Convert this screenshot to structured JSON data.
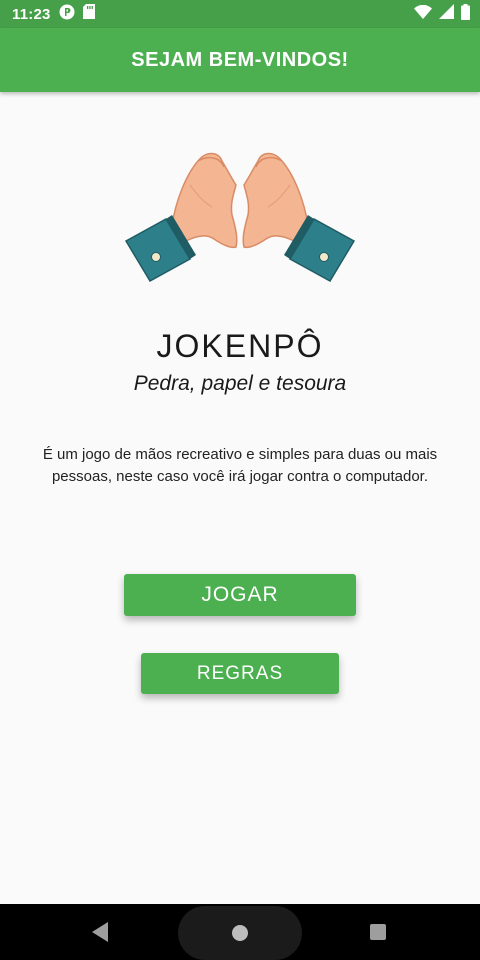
{
  "status_bar": {
    "time": "11:23"
  },
  "app_bar": {
    "title": "SEJAM BEM-VINDOS!"
  },
  "main": {
    "title": "JOKENPÔ",
    "subtitle": "Pedra, papel e tesoura",
    "description": "É um jogo de mãos recreativo e simples para duas ou mais pessoas, neste caso você irá jogar contra o computador.",
    "play_button": "JOGAR",
    "rules_button": "REGRAS"
  },
  "colors": {
    "primary": "#4caf50",
    "primary_dark": "#46a049",
    "background": "#fafafa",
    "skin": "#f4b692",
    "cuff": "#2d7f8a"
  },
  "icons": {
    "status_left": [
      "notification-icon",
      "sd-card-icon"
    ],
    "status_right": [
      "wifi-icon",
      "signal-icon",
      "battery-icon"
    ],
    "hero": "heart-hands-icon",
    "nav": [
      "back-icon",
      "home-icon",
      "recents-icon"
    ]
  }
}
